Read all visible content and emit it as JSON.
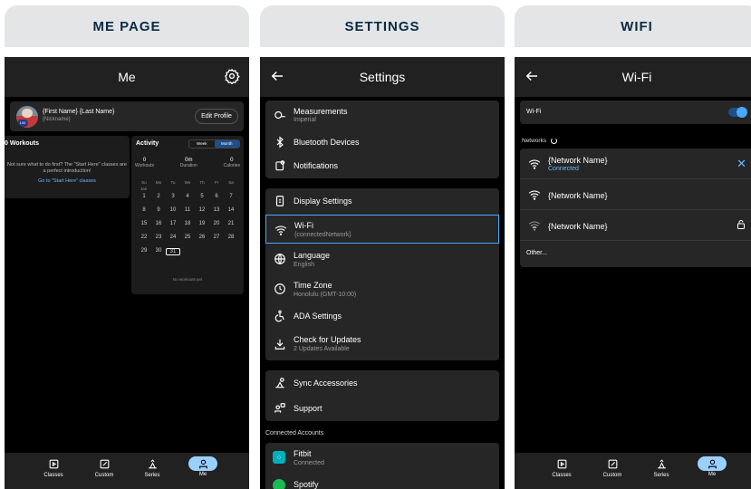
{
  "panels": {
    "me": {
      "banner": "ME PAGE"
    },
    "settings": {
      "banner": "SETTINGS"
    },
    "wifi": {
      "banner": "WIFI"
    }
  },
  "me_page": {
    "title": "Me",
    "profile": {
      "name": "{First Name} {Last Name}",
      "nickname": "{Nickname}",
      "avatar_badge": "100",
      "edit_label": "Edit Profile"
    },
    "workouts": {
      "title": "0 Workouts",
      "message": "Not sure what to do first? The \"Start Here\" classes are a perfect introduction!",
      "link": "Go to \"Start Here\" classes"
    },
    "activity": {
      "title": "Activity",
      "toggle": {
        "week": "Week",
        "month": "Month"
      },
      "stats": [
        {
          "value": "0",
          "label": "Workouts"
        },
        {
          "value": "0m",
          "label": "Duration"
        },
        {
          "value": "0",
          "label": "Calories"
        }
      ],
      "weekdays": [
        "Su",
        "Mo",
        "Tu",
        "We",
        "Th",
        "Fr",
        "Sa"
      ],
      "month": "Jan",
      "days": [
        "1",
        "2",
        "3",
        "4",
        "5",
        "6",
        "7",
        "8",
        "9",
        "10",
        "11",
        "12",
        "13",
        "14",
        "15",
        "16",
        "17",
        "18",
        "19",
        "20",
        "21",
        "22",
        "23",
        "24",
        "25",
        "26",
        "27",
        "28",
        "29",
        "30",
        "31"
      ],
      "selected_day": "31",
      "empty": "No workouts yet"
    }
  },
  "settings_page": {
    "title": "Settings",
    "group1": [
      {
        "label": "Measurements",
        "sub": "Imperial",
        "icon": "tape-measure-icon"
      },
      {
        "label": "Bluetooth Devices",
        "sub": "",
        "icon": "bluetooth-icon"
      },
      {
        "label": "Notifications",
        "sub": "",
        "icon": "notification-icon"
      }
    ],
    "group2": [
      {
        "label": "Display Settings",
        "sub": "",
        "icon": "display-icon"
      },
      {
        "label": "Wi-Fi",
        "sub": "{connectedNetwork}",
        "icon": "wifi-icon"
      },
      {
        "label": "Language",
        "sub": "English",
        "icon": "globe-icon"
      },
      {
        "label": "Time Zone",
        "sub": "Honolulu (GMT-10:00)",
        "icon": "clock-icon"
      },
      {
        "label": "ADA Settings",
        "sub": "",
        "icon": "accessibility-icon"
      },
      {
        "label": "Check for Updates",
        "sub": "2 Updates Available",
        "icon": "download-icon"
      }
    ],
    "group3": [
      {
        "label": "Sync Accessories",
        "sub": "",
        "icon": "sync-accessories-icon"
      },
      {
        "label": "Support",
        "sub": "",
        "icon": "support-icon"
      }
    ],
    "connected_title": "Connected Accounts",
    "accounts": [
      {
        "label": "Fitbit",
        "sub": "Connected",
        "color": "#00b0b9"
      },
      {
        "label": "Spotify",
        "sub": "",
        "color": "#1db954"
      }
    ]
  },
  "wifi_page": {
    "title": "Wi-Fi",
    "toggle_label": "Wi-Fi",
    "toggle_on": true,
    "networks_label": "Networks",
    "networks": [
      {
        "name": "{Network Name}",
        "status": "Connected"
      },
      {
        "name": "{Network Name}",
        "status": ""
      },
      {
        "name": "{Network Name}",
        "status": ""
      }
    ],
    "other": "Other..."
  },
  "nav": [
    {
      "label": "Classes",
      "icon": "classes-icon"
    },
    {
      "label": "Custom",
      "icon": "custom-icon"
    },
    {
      "label": "Series",
      "icon": "series-icon"
    },
    {
      "label": "Me",
      "icon": "me-icon"
    }
  ],
  "colors": {
    "accent": "#4aa8ff",
    "selected_outline": "#4aa8ff",
    "nav_active": "#9ad0ff"
  }
}
